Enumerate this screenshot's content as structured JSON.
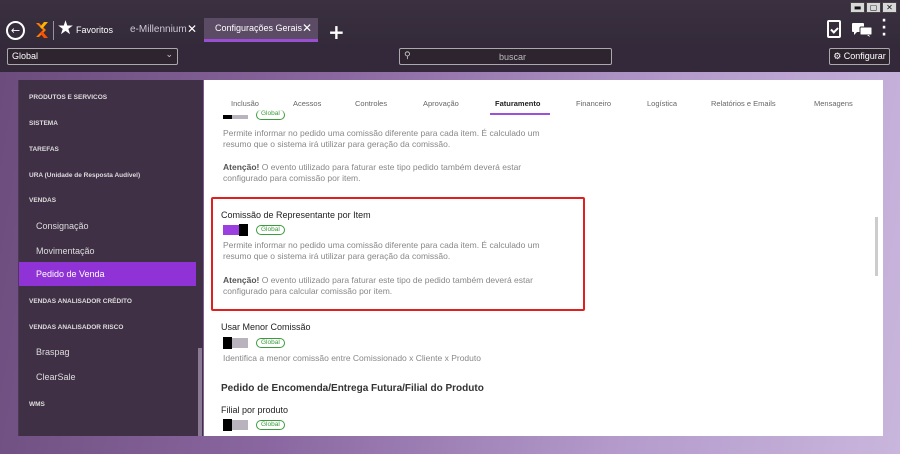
{
  "window": {
    "minimize": "▬",
    "maximize": "▢",
    "close": "✕"
  },
  "topbar": {
    "favorites_label": "Favoritos",
    "tabs": [
      {
        "label": "e-Millennium",
        "close": "✕"
      },
      {
        "label": "Configurações Gerais",
        "close": "✕"
      }
    ],
    "add_tab": "+"
  },
  "toolbar": {
    "scope_select": "Global",
    "search_placeholder": "buscar",
    "configure_label": "⚙ Configurar"
  },
  "sidebar": {
    "items": [
      {
        "label": "PRODUTOS E SERVICOS",
        "type": "group"
      },
      {
        "label": "SISTEMA",
        "type": "group"
      },
      {
        "label": "TAREFAS",
        "type": "group"
      },
      {
        "label": "URA (Unidade de Resposta Audível)",
        "type": "group"
      },
      {
        "label": "VENDAS",
        "type": "group"
      },
      {
        "label": "Consignação",
        "type": "sub"
      },
      {
        "label": "Movimentação",
        "type": "sub"
      },
      {
        "label": "Pedido de Venda",
        "type": "sub",
        "active": true
      },
      {
        "label": "VENDAS ANALISADOR CRÉDITO",
        "type": "group"
      },
      {
        "label": "VENDAS ANALISADOR RISCO",
        "type": "group"
      },
      {
        "label": "Braspag",
        "type": "sub"
      },
      {
        "label": "ClearSale",
        "type": "sub"
      },
      {
        "label": "WMS",
        "type": "group"
      }
    ]
  },
  "content": {
    "tabs": [
      "Inclusão",
      "Acessos",
      "Controles",
      "Aprovação",
      "Faturamento",
      "Financeiro",
      "Logística",
      "Relatórios e Emails",
      "Mensagens"
    ],
    "active_tab": "Faturamento",
    "settings": [
      {
        "badge": "Global",
        "desc1": "Permite informar no pedido uma comissão diferente para cada item. É calculado um",
        "desc2": "resumo que o sistema irá utilizar para geração da comissão.",
        "warn_bold": "Atenção!",
        "warn1": " O evento utilizado para faturar este tipo pedido também deverá estar",
        "warn2": "configurado para comissão por item."
      },
      {
        "title": "Comissão de Representante por Item",
        "badge": "Global",
        "enabled": true,
        "desc1": "Permite informar no pedido uma comissão diferente para cada item. É calculado um",
        "desc2": "resumo que o sistema irá utilizar para geração da comissão.",
        "warn_bold": "Atenção!",
        "warn1": " O evento utilizado para faturar este tipo de pedido também deverá estar",
        "warn2": "configurado para calcular comissão por item."
      },
      {
        "title": "Usar Menor Comissão",
        "badge": "Global",
        "enabled": false,
        "desc1": "Identifica a menor comissão entre Comissionado x Cliente x Produto"
      }
    ],
    "section_title": "Pedido de Encomenda/Entrega Futura/Filial do Produto",
    "setting_last": {
      "title": "Filial por produto",
      "badge": "Global",
      "enabled": false
    }
  },
  "colors": {
    "accent": "#9033d6",
    "toggle_on": "#9b3fe0",
    "badge_green": "#3a9c3a",
    "highlight": "#e02020"
  }
}
